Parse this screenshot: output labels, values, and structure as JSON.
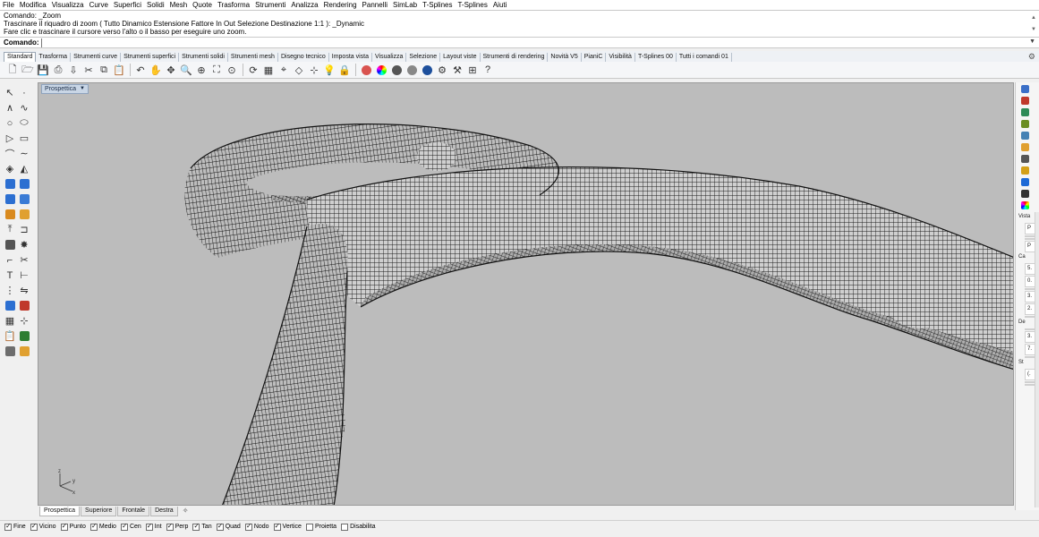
{
  "menu": [
    "File",
    "Modifica",
    "Visualizza",
    "Curve",
    "Superfici",
    "Solidi",
    "Mesh",
    "Quote",
    "Trasforma",
    "Strumenti",
    "Analizza",
    "Rendering",
    "Pannelli",
    "SimLab",
    "T-Splines",
    "T-Splines",
    "Aiuti"
  ],
  "command_history": [
    "Comando: _Zoom",
    "Trascinare il riquadro di zoom ( Tutto  Dinamico  Estensione  Fattore  In  Out  Selezione  Destinazione  1:1 ): _Dynamic",
    "Fare clic e trascinare il cursore verso l'alto o il basso per eseguire uno zoom."
  ],
  "command_prompt": {
    "label": "Comando:",
    "value": ""
  },
  "tabs": [
    "Standard",
    "Trasforma",
    "Strumenti curve",
    "Strumenti superfici",
    "Strumenti solidi",
    "Strumenti mesh",
    "Disegno tecnico",
    "Imposta vista",
    "Visualizza",
    "Selezione",
    "Layout viste",
    "Strumenti di rendering",
    "Novità V5",
    "PianiC",
    "Visibilità",
    "T-Splines 00",
    "Tutti i comandi 01"
  ],
  "active_tab": "Standard",
  "toolbar_icons": [
    "new-file-icon",
    "open-file-icon",
    "save-icon",
    "print-icon",
    "import-icon",
    "cut-icon",
    "copy-icon",
    "paste-icon",
    "undo-icon",
    "pan-icon",
    "move-view-icon",
    "zoom-icon",
    "zoom-window-icon",
    "zoom-extents-icon",
    "zoom-selected-icon",
    "rotate-view-icon",
    "four-views-icon",
    "osnap-icon",
    "plane-icon",
    "snap-icon",
    "light-icon",
    "lock-icon",
    "material-icon",
    "color-wheel-icon",
    "render-sphere-icon",
    "shaded-sphere-icon",
    "rendered-sphere-icon",
    "properties-icon",
    "settings-icon",
    "layout-icon",
    "help-icon"
  ],
  "left_tool_icons": [
    [
      "select-icon",
      "point-icon"
    ],
    [
      "polyline-icon",
      "curve-icon"
    ],
    [
      "circle-icon",
      "ellipse-icon"
    ],
    [
      "polygon-icon",
      "rectangle-icon"
    ],
    [
      "arc-icon",
      "freeform-icon"
    ],
    [
      "surface-icon",
      "loft-icon"
    ],
    [
      "box-icon",
      "sphere-icon"
    ],
    [
      "cylinder-icon",
      "mesh-icon"
    ],
    [
      "boolean-icon",
      "fillet-icon"
    ],
    [
      "extrude-icon",
      "cap-icon"
    ],
    [
      "group-icon",
      "explode-icon"
    ],
    [
      "fillet-edge-icon",
      "trim-icon"
    ],
    [
      "text-icon",
      "dimension-icon"
    ],
    [
      "array-icon",
      "mirror-icon"
    ],
    [
      "render-icon",
      "material-icon"
    ],
    [
      "grid-icon",
      "snap-icon"
    ],
    [
      "clipboard-icon",
      "check-icon"
    ],
    [
      "analyze-icon",
      "warning-icon"
    ]
  ],
  "viewport": {
    "label": "Prospettica",
    "axis": {
      "x": "x",
      "y": "y",
      "z": "z"
    }
  },
  "view_tabs": [
    "Prospettica",
    "Superiore",
    "Frontale",
    "Destra"
  ],
  "active_view_tab": "Prospettica",
  "osnaps": [
    {
      "label": "Fine",
      "checked": true
    },
    {
      "label": "Vicino",
      "checked": true
    },
    {
      "label": "Punto",
      "checked": true
    },
    {
      "label": "Medio",
      "checked": true
    },
    {
      "label": "Cen",
      "checked": true
    },
    {
      "label": "Int",
      "checked": true
    },
    {
      "label": "Perp",
      "checked": true
    },
    {
      "label": "Tan",
      "checked": true
    },
    {
      "label": "Quad",
      "checked": true
    },
    {
      "label": "Nodo",
      "checked": true
    },
    {
      "label": "Vertice",
      "checked": true
    },
    {
      "label": "Proietta",
      "checked": false
    },
    {
      "label": "Disabilita",
      "checked": false
    }
  ],
  "right_icons": [
    "properties-icon",
    "layers-icon",
    "layer-stack-icon",
    "materials-icon",
    "display-icon",
    "help-icon",
    "named-views-icon",
    "lights-icon",
    "render-icon",
    "env-icon",
    "color-icon"
  ],
  "right_props": [
    "Vista",
    "P",
    "",
    "",
    "P",
    "Ca",
    "5.",
    "0.",
    "",
    "3.",
    "2.",
    "",
    "De",
    "",
    "3.",
    "7.",
    "",
    "St",
    "(.",
    "",
    ""
  ],
  "colors": {
    "viewport_bg": "#bcbcbc",
    "mesh_line": "#1c1c1c",
    "menu_bg": "#ffffff",
    "tab_bg": "#eef1f5",
    "view_label_bg": "#c9d6e6"
  }
}
